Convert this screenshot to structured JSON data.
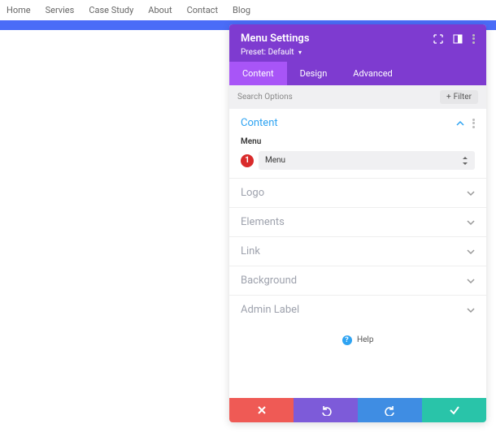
{
  "nav": {
    "items": [
      "Home",
      "Servies",
      "Case Study",
      "About",
      "Contact",
      "Blog"
    ]
  },
  "panel": {
    "title": "Menu Settings",
    "preset_label": "Preset:",
    "preset_value": "Default"
  },
  "tabs": {
    "content": "Content",
    "design": "Design",
    "advanced": "Advanced"
  },
  "search": {
    "placeholder": "Search Options",
    "filter_label": "Filter"
  },
  "sections": {
    "content": {
      "title": "Content"
    },
    "menu_field": {
      "label": "Menu",
      "badge": "1",
      "value": "Menu"
    },
    "logo": "Logo",
    "elements": "Elements",
    "link": "Link",
    "background": "Background",
    "admin_label": "Admin Label"
  },
  "help": {
    "label": "Help"
  }
}
